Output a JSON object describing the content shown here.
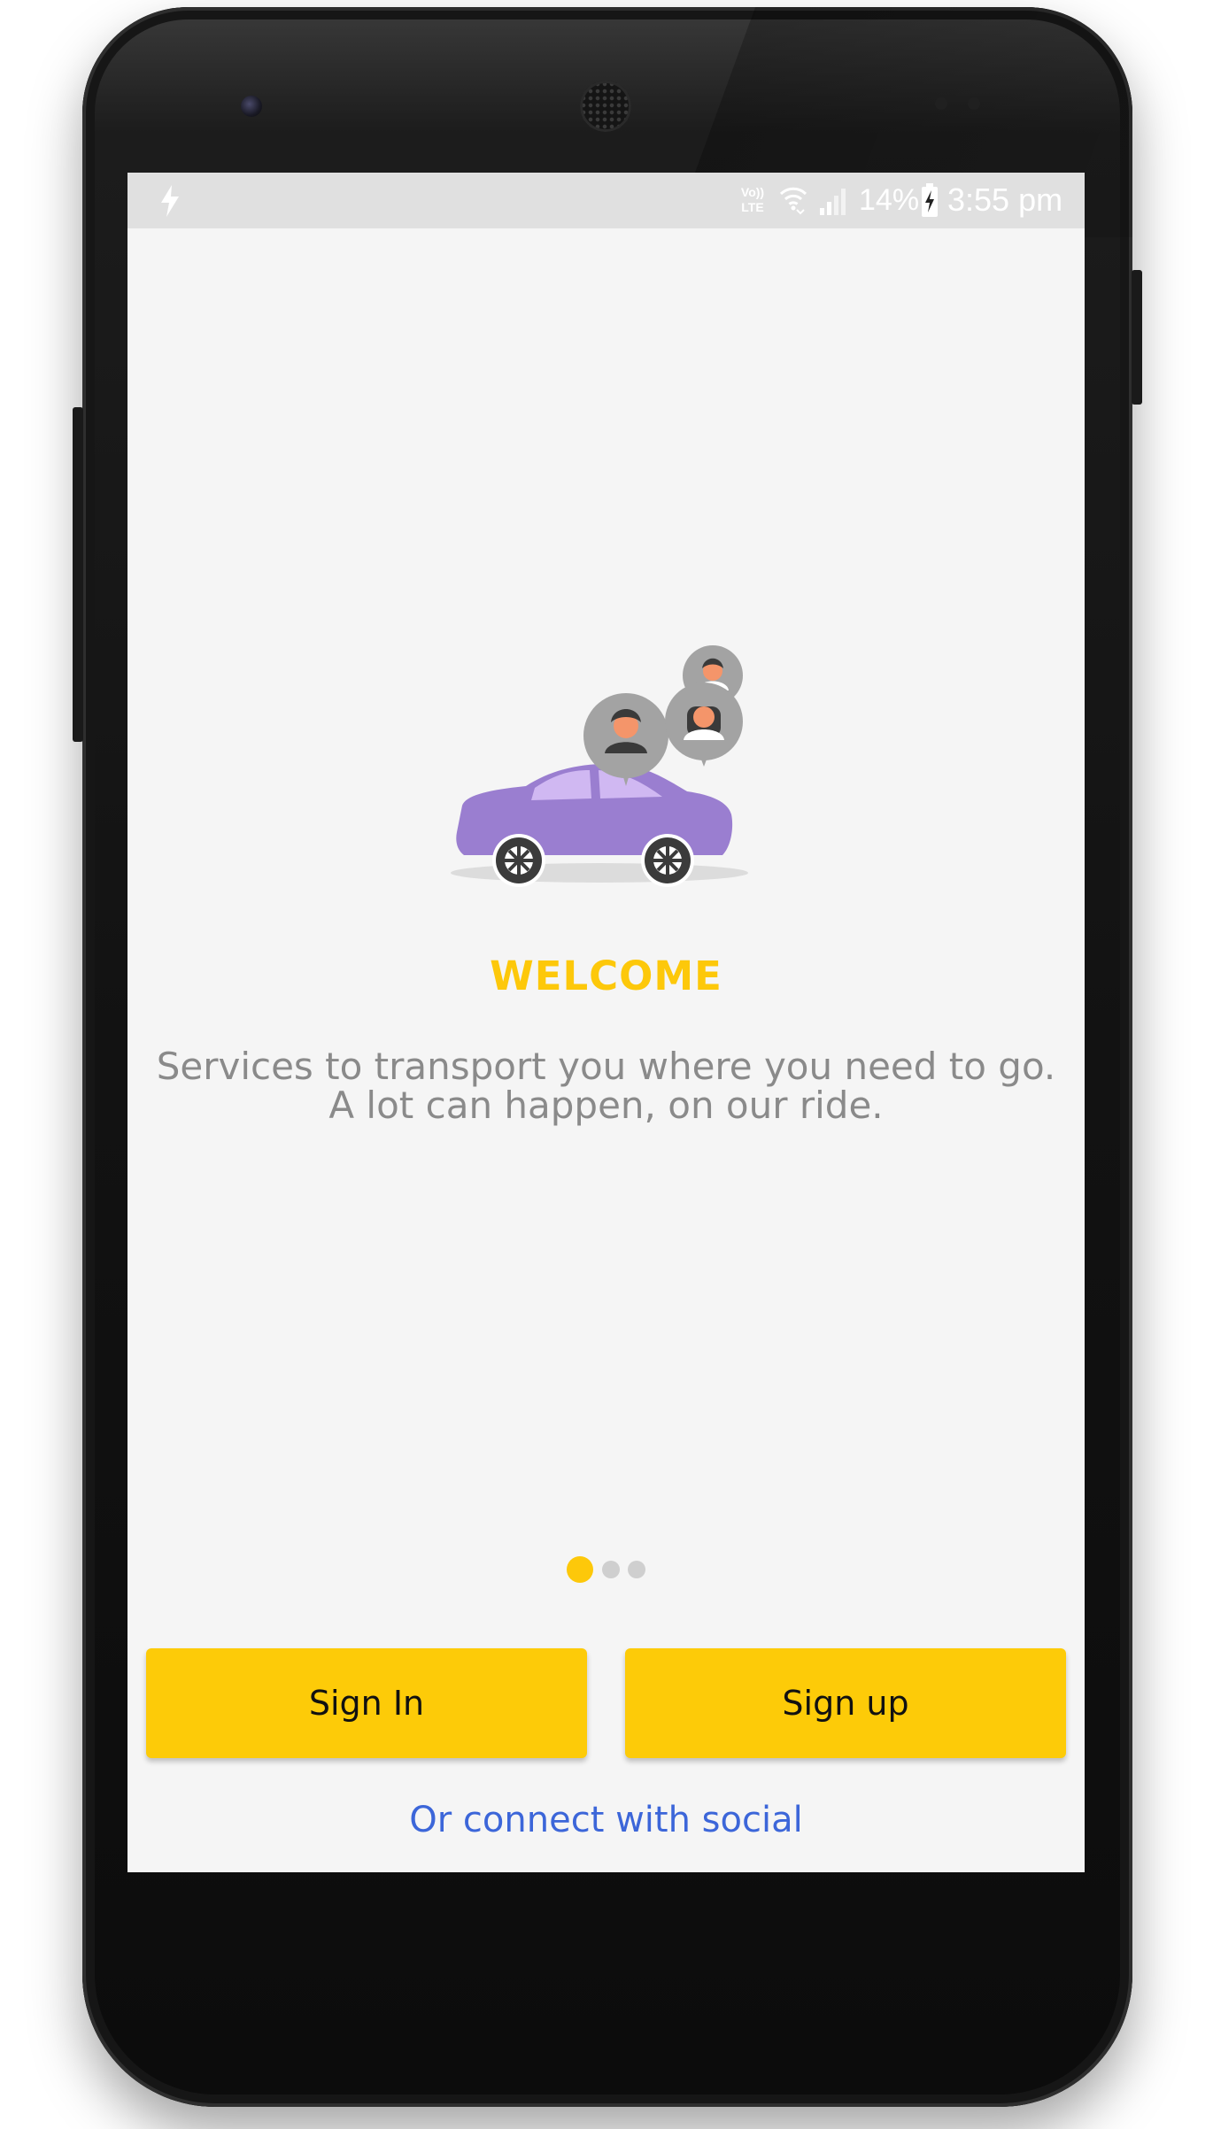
{
  "status_bar": {
    "lte": "Vo)) LTE",
    "battery_percent": "14%",
    "time": "3:55 pm"
  },
  "onboarding": {
    "title": "WELCOME",
    "description": "Services to transport you where you need to go. A lot can happen, on our ride.",
    "page_count": 3,
    "active_page": 1
  },
  "actions": {
    "sign_in_label": "Sign In",
    "sign_up_label": "Sign up",
    "social_link_label": "Or connect with social"
  },
  "colors": {
    "accent": "#fdc80a",
    "button": "#fdcb08",
    "link": "#3c66d9",
    "car": "#9a7ed0",
    "screen_bg": "#f5f5f5"
  }
}
